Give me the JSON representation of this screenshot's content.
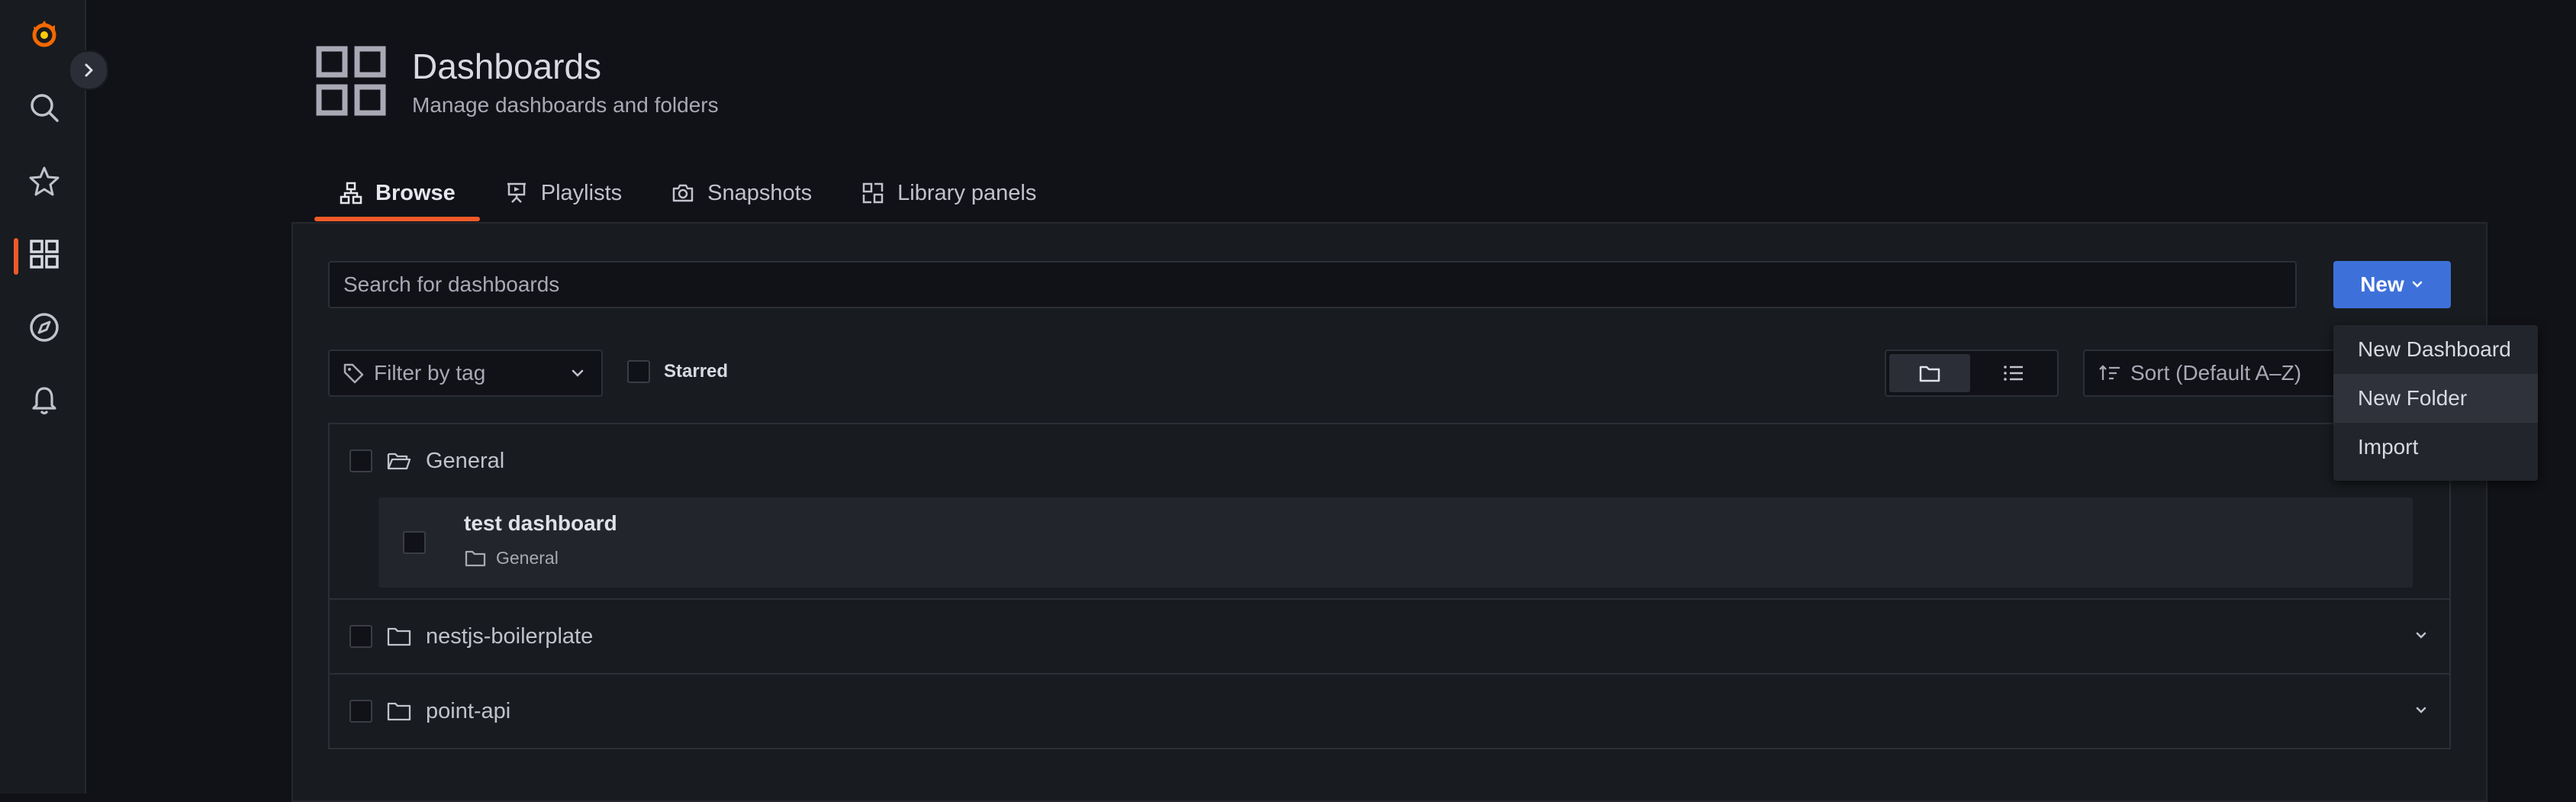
{
  "header": {
    "title": "Dashboards",
    "subtitle": "Manage dashboards and folders"
  },
  "tabs": [
    {
      "label": "Browse",
      "icon": "sitemap-icon",
      "active": true
    },
    {
      "label": "Playlists",
      "icon": "presentation-icon"
    },
    {
      "label": "Snapshots",
      "icon": "camera-icon"
    },
    {
      "label": "Library panels",
      "icon": "library-panel-icon"
    }
  ],
  "search": {
    "placeholder": "Search for dashboards"
  },
  "new_button": {
    "label": "New"
  },
  "new_menu": [
    "New Dashboard",
    "New Folder",
    "Import"
  ],
  "filter": {
    "placeholder": "Filter by tag"
  },
  "starred": {
    "label": "Starred"
  },
  "sort": {
    "label": "Sort (Default A–Z)"
  },
  "folders": [
    {
      "name": "General",
      "expanded": true,
      "dashboards": [
        {
          "title": "test dashboard",
          "folder": "General"
        }
      ]
    },
    {
      "name": "nestjs-boilerplate",
      "expanded": false
    },
    {
      "name": "point-api",
      "expanded": false
    }
  ],
  "colors": {
    "accent": "#f05a28",
    "primary": "#3d71d9",
    "background": "#111217"
  }
}
